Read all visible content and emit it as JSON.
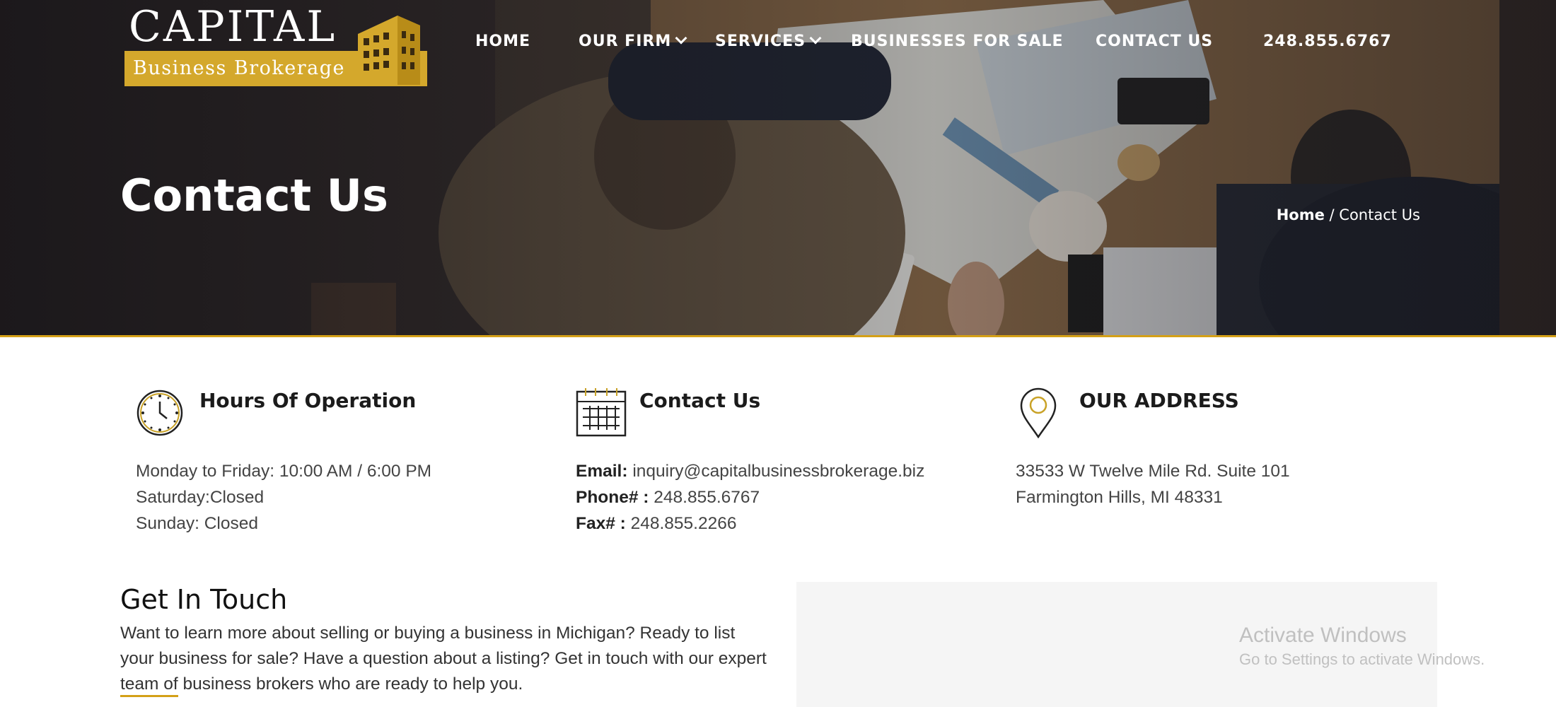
{
  "logo": {
    "word": "CAPITAL",
    "sub": "Business Brokerage"
  },
  "nav": {
    "items": [
      {
        "label": "HOME"
      },
      {
        "label": "OUR FIRM"
      },
      {
        "label": "SERVICES"
      },
      {
        "label": "BUSINESSES FOR SALE"
      },
      {
        "label": "CONTACT US"
      },
      {
        "label": "248.855.6767"
      }
    ]
  },
  "hero": {
    "title": "Contact Us",
    "breadcrumb_home": "Home",
    "breadcrumb_sep": " / ",
    "breadcrumb_current": "Contact Us"
  },
  "hours": {
    "icon": "clock-icon",
    "title": "Hours Of Operation",
    "lines": [
      "Monday to Friday: 10:00 AM / 6:00 PM",
      "Saturday:Closed",
      "Sunday: Closed"
    ]
  },
  "contact": {
    "icon": "calendar-icon",
    "title": "Contact Us",
    "email_label": "Email:",
    "email_value": " inquiry@capitalbusinessbrokerage.biz",
    "phone_label": "Phone# :",
    "phone_value": " 248.855.6767",
    "fax_label": "Fax# :",
    "fax_value": " 248.855.2266"
  },
  "address": {
    "icon": "map-pin-icon",
    "title": "OUR ADDRESS",
    "lines": [
      "33533 W Twelve Mile Rd. Suite 101",
      "Farmington Hills, MI 48331"
    ]
  },
  "get_in_touch": {
    "title": "Get In Touch",
    "text": "Want to learn more about selling or buying a business in Michigan? Ready to list your business for sale? Have a question about a listing? Get in touch with our expert team of business brokers who are ready to help you."
  },
  "watermark": {
    "line1": "Activate Windows",
    "line2": "Go to Settings to activate Windows."
  },
  "colors": {
    "accent": "#d4a017",
    "hero_dark": "#2a2526",
    "text": "#333333"
  }
}
